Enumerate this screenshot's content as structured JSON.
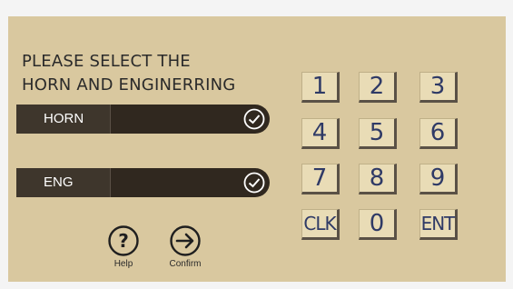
{
  "prompt": {
    "line1": "PLEASE SELECT THE",
    "line2": "HORN AND ENGINERRING"
  },
  "options": [
    {
      "label": "HORN",
      "icon": "check-circle-icon",
      "checked": true
    },
    {
      "label": "ENG",
      "icon": "check-circle-icon",
      "checked": true
    }
  ],
  "keypad": {
    "k1": "1",
    "k2": "2",
    "k3": "3",
    "k4": "4",
    "k5": "5",
    "k6": "6",
    "k7": "7",
    "k8": "8",
    "k9": "9",
    "clk": "CLK",
    "k0": "0",
    "ent": "ENT"
  },
  "help": {
    "label": "Help",
    "icon": "question-circle-icon"
  },
  "confirm": {
    "label": "Confirm",
    "icon": "arrow-right-circle-icon"
  },
  "colors": {
    "panel": "#d9c89f",
    "bar": "#30281f",
    "key_face": "#e9dcb6",
    "key_text": "#2f3a66"
  }
}
